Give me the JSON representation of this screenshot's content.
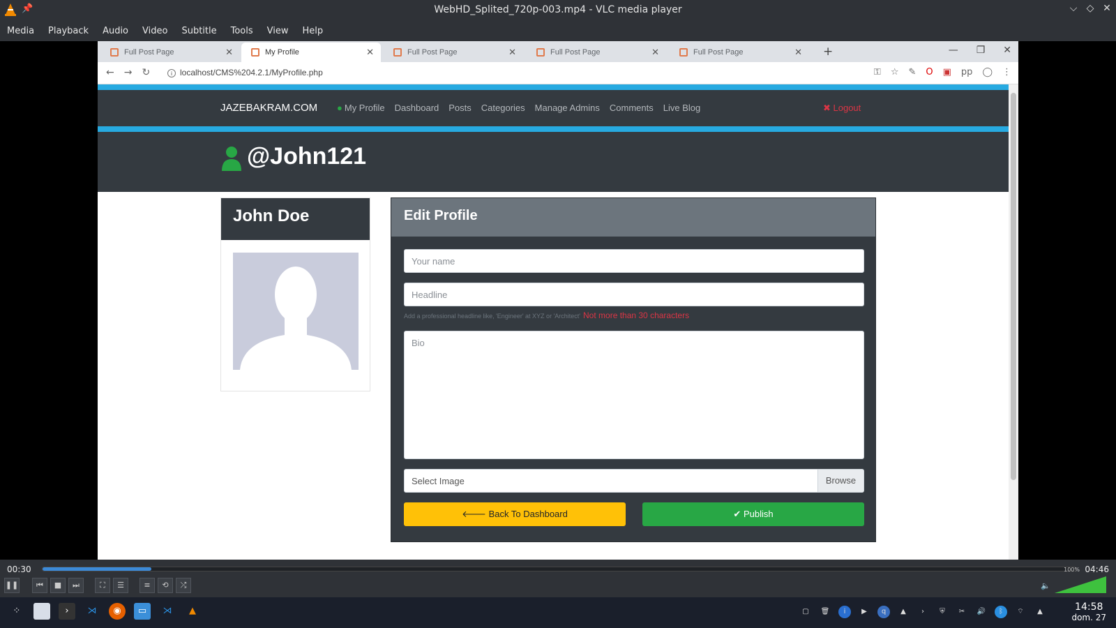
{
  "window": {
    "title": "WebHD_Splited_720p-003.mp4 - VLC media player"
  },
  "menu": [
    "Media",
    "Playback",
    "Audio",
    "Video",
    "Subtitle",
    "Tools",
    "View",
    "Help"
  ],
  "browser": {
    "tabs": [
      {
        "label": "Full Post Page",
        "active": false
      },
      {
        "label": "My Profile",
        "active": true
      },
      {
        "label": "Full Post Page",
        "active": false
      },
      {
        "label": "Full Post Page",
        "active": false
      },
      {
        "label": "Full Post Page",
        "active": false
      }
    ],
    "url": "localhost/CMS%204.2.1/MyProfile.php"
  },
  "site": {
    "brand": "JAZEBAKRAM.COM",
    "nav": [
      "My Profile",
      "Dashboard",
      "Posts",
      "Categories",
      "Manage Admins",
      "Comments",
      "Live Blog"
    ],
    "logout": "Logout",
    "username": "@John121",
    "profile_name": "John Doe"
  },
  "form": {
    "title": "Edit Profile",
    "name_placeholder": "Your name",
    "headline_placeholder": "Headline",
    "hint": "Add a professional headline like, 'Engineer' at XYZ or 'Architect'",
    "hint_warning": "Not more than 30 characters",
    "bio_placeholder": "Bio",
    "image_placeholder": "Select Image",
    "browse_label": "Browse",
    "back_label": "Back To Dashboard",
    "publish_label": "Publish"
  },
  "player": {
    "elapsed": "00:30",
    "duration": "04:46",
    "progress": 0.105,
    "volume_label": "100%",
    "volume": 1.0
  },
  "taskbar": {
    "time": "14:58",
    "date": "dom. 27"
  },
  "colors": {
    "accent_blue": "#27aae1",
    "navbar_dark": "#343a40",
    "success": "#28a745",
    "warning": "#ffc107",
    "danger": "#dc3545"
  }
}
